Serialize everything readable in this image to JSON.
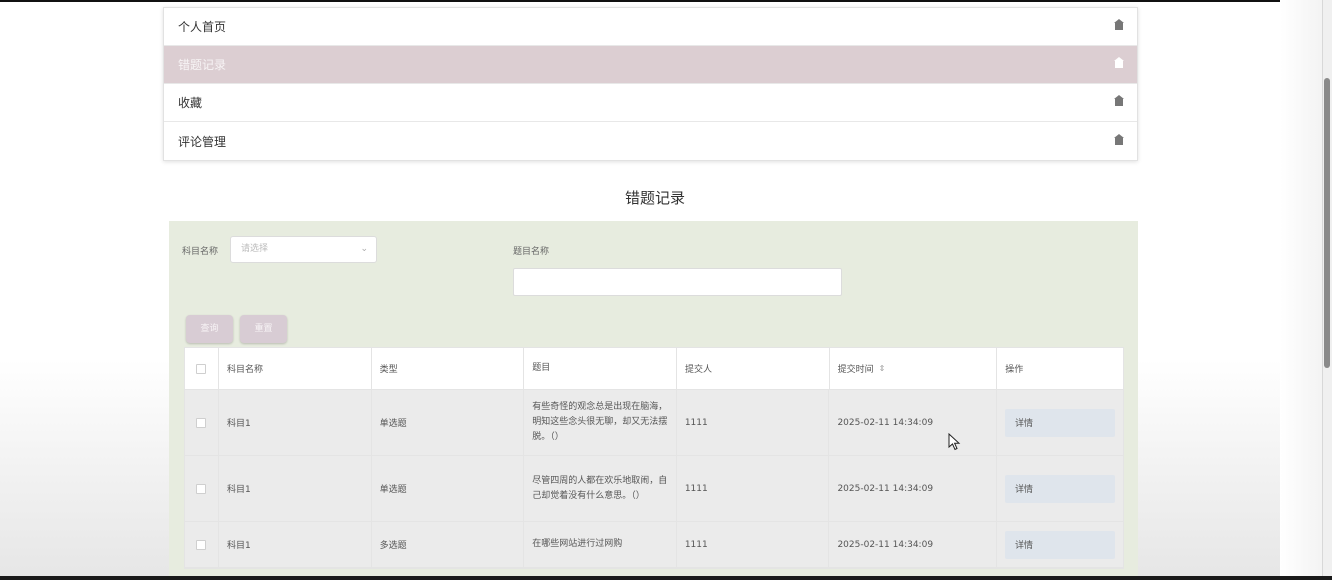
{
  "menu": {
    "items": [
      {
        "label": "个人首页",
        "active": false
      },
      {
        "label": "错题记录",
        "active": true
      },
      {
        "label": "收藏",
        "active": false
      },
      {
        "label": "评论管理",
        "active": false
      }
    ],
    "item_icon": "home-icon"
  },
  "page_title": "错题记录",
  "search": {
    "subject_label": "科目名称",
    "subject_placeholder": "请选择",
    "question_label": "题目名称",
    "question_value": "",
    "query_button": "查询",
    "reset_button": "重置"
  },
  "table": {
    "columns": [
      "科目名称",
      "类型",
      "题目",
      "提交人",
      "提交时间",
      "操作"
    ],
    "sort_icon": "⇕",
    "rows": [
      {
        "subject": "科目1",
        "type": "单选题",
        "question": "有些奇怪的观念总是出现在脑海，明知这些念头很无聊，却又无法摆脱。（）",
        "submitter": "1111",
        "time": "2025-02-11 14:34:09",
        "action": "详情"
      },
      {
        "subject": "科目1",
        "type": "单选题",
        "question": "尽管四周的人都在欢乐地取闹，自己却觉着没有什么意思。（）",
        "submitter": "1111",
        "time": "2025-02-11 14:34:09",
        "action": "详情"
      },
      {
        "subject": "科目1",
        "type": "多选题",
        "question": "在哪些网站进行过网购",
        "submitter": "1111",
        "time": "2025-02-11 14:34:09",
        "action": "详情"
      }
    ]
  },
  "colors": {
    "active_menu_bg": "#dcced2",
    "panel_bg": "#e7ecdf",
    "button_bg": "#d8ccd4",
    "detail_button_bg": "#dfe5ec"
  }
}
